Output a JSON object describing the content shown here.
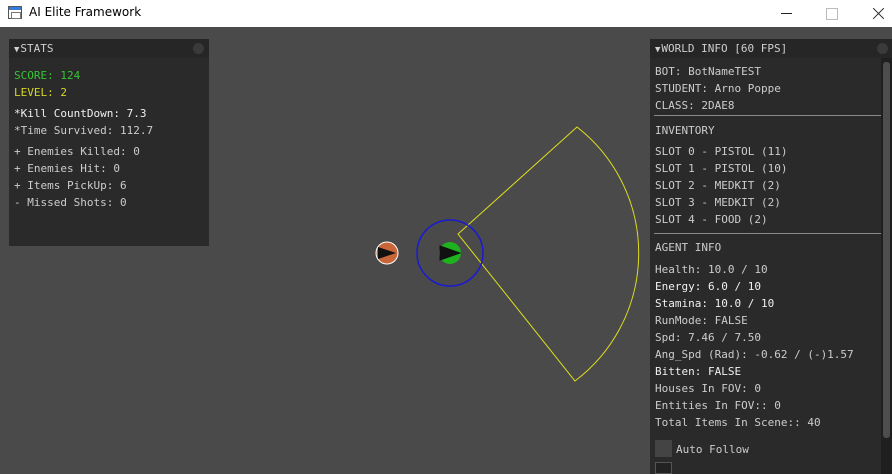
{
  "window": {
    "title": "AI Elite Framework",
    "icon": "app-window-icon"
  },
  "stats": {
    "header": "STATS",
    "score": "SCORE: 124",
    "level": "LEVEL: 2",
    "kill_countdown": "*Kill CountDown: 7.3",
    "time_survived": "*Time Survived: 112.7",
    "enemies_killed": "+ Enemies Killed: 0",
    "enemies_hit": "+ Enemies Hit: 0",
    "items_pickup": "+ Items PickUp: 6",
    "missed_shots": "- Missed Shots: 0",
    "score_color": "#35c535",
    "level_color": "#d6d622"
  },
  "world": {
    "header": "WORLD INFO [60 FPS]",
    "bot": "BOT: BotNameTEST",
    "student": "STUDENT: Arno Poppe",
    "class": "CLASS: 2DAE8",
    "inventory_title": "INVENTORY",
    "inventory": [
      "SLOT 0 - PISTOL (11)",
      "SLOT 1 - PISTOL (10)",
      "SLOT 2 - MEDKIT (2)",
      "SLOT 3 - MEDKIT (2)",
      "SLOT 4 - FOOD (2)"
    ],
    "agent_title": "AGENT INFO",
    "health": "Health: 10.0 / 10",
    "energy": "Energy: 6.0 / 10",
    "stamina": "Stamina: 10.0 / 10",
    "run_mode": "RunMode: FALSE",
    "speed": "Spd: 7.46 / 7.50",
    "ang_speed": "Ang_Spd (Rad): -0.62 / (-)1.57",
    "bitten": "Bitten: FALSE",
    "houses_fov": "Houses In FOV: 0",
    "entities_fov": "Entities In FOV:: 0",
    "total_items": "Total Items In Scene:: 40",
    "auto_follow": "Auto Follow"
  },
  "scene": {
    "agent_color": "#1fb11f",
    "agent_ring_color": "#1a1ad0",
    "fov_color": "#dede1e",
    "enemy_color": "#c8663a"
  }
}
